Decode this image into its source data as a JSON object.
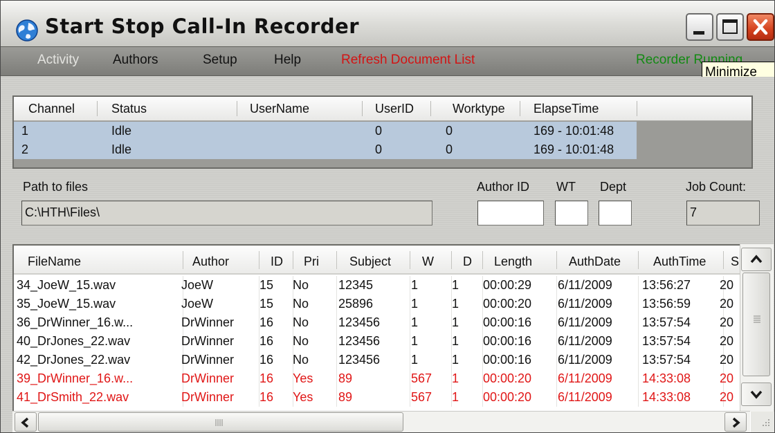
{
  "window": {
    "title": "Start Stop Call-In Recorder",
    "tooltip": "Minimize"
  },
  "menu": {
    "items": [
      {
        "label": "Activity",
        "enabled": false
      },
      {
        "label": "Authors",
        "enabled": true
      },
      {
        "label": "Setup",
        "enabled": true
      },
      {
        "label": "Help",
        "enabled": true
      },
      {
        "label": "Refresh Document List",
        "enabled": true,
        "color": "#d21414"
      }
    ],
    "status": "Recorder Running",
    "status_color": "#138a13"
  },
  "channels": {
    "columns": [
      "Channel",
      "Status",
      "UserName",
      "UserID",
      "Worktype",
      "ElapseTime"
    ],
    "rows": [
      [
        "1",
        "Idle",
        "",
        "0",
        "0",
        "169 - 10:01:48"
      ],
      [
        "2",
        "Idle",
        "",
        "0",
        "0",
        "169 - 10:01:48"
      ]
    ],
    "selected_color": "#b8c9dc"
  },
  "files_panel": {
    "path_label": "Path to files",
    "path_value": "C:\\HTH\\Files\\",
    "author_id_label": "Author ID",
    "author_id_value": "",
    "wt_label": "WT",
    "wt_value": "",
    "dept_label": "Dept",
    "dept_value": "",
    "job_count_label": "Job Count:",
    "job_count_value": "7"
  },
  "file_list": {
    "columns": [
      "FileName",
      "Author",
      "ID",
      "Pri",
      "Subject",
      "W",
      "D",
      "Length",
      "AuthDate",
      "AuthTime",
      "S"
    ],
    "rows": [
      {
        "cells": [
          "34_JoeW_15.wav",
          "JoeW",
          "15",
          "No",
          "12345",
          "1",
          "1",
          "00:00:29",
          "6/11/2009",
          "13:56:27",
          "20"
        ],
        "priority": false
      },
      {
        "cells": [
          "35_JoeW_15.wav",
          "JoeW",
          "15",
          "No",
          "25896",
          "1",
          "1",
          "00:00:20",
          "6/11/2009",
          "13:56:59",
          "20"
        ],
        "priority": false
      },
      {
        "cells": [
          "36_DrWinner_16.w...",
          "DrWinner",
          "16",
          "No",
          "123456",
          "1",
          "1",
          "00:00:16",
          "6/11/2009",
          "13:57:54",
          "20"
        ],
        "priority": false
      },
      {
        "cells": [
          "40_DrJones_22.wav",
          "DrWinner",
          "16",
          "No",
          "123456",
          "1",
          "1",
          "00:00:16",
          "6/11/2009",
          "13:57:54",
          "20"
        ],
        "priority": false
      },
      {
        "cells": [
          "42_DrJones_22.wav",
          "DrWinner",
          "16",
          "No",
          "123456",
          "1",
          "1",
          "00:00:16",
          "6/11/2009",
          "13:57:54",
          "20"
        ],
        "priority": false
      },
      {
        "cells": [
          "39_DrWinner_16.w...",
          "DrWinner",
          "16",
          "Yes",
          "89",
          "567",
          "1",
          "00:00:20",
          "6/11/2009",
          "14:33:08",
          "20"
        ],
        "priority": true
      },
      {
        "cells": [
          "41_DrSmith_22.wav",
          "DrWinner",
          "16",
          "Yes",
          "89",
          "567",
          "1",
          "00:00:20",
          "6/11/2009",
          "14:33:08",
          "20"
        ],
        "priority": true
      }
    ],
    "priority_color": "#e01616"
  }
}
